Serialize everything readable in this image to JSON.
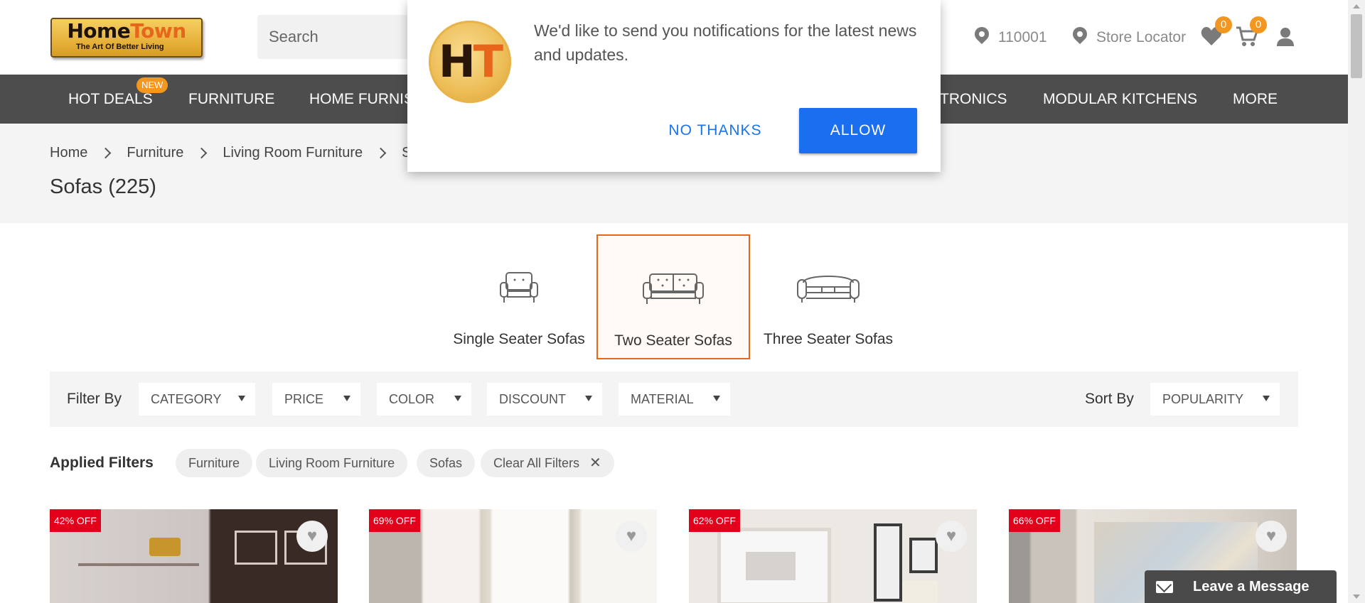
{
  "brand": {
    "name_part1": "Home",
    "name_part2": "Town",
    "tagline": "The Art Of Better Living",
    "accent_color": "#e8651c"
  },
  "header": {
    "search_placeholder": "Search",
    "pincode": "110001",
    "store_locator": "Store Locator",
    "wishlist_count": "0",
    "cart_count": "0",
    "icons": [
      "location-pin-icon",
      "heart-icon",
      "cart-icon",
      "user-icon"
    ]
  },
  "nav": {
    "items": [
      "HOT DEALS",
      "FURNITURE",
      "HOME FURNIS",
      "TRONICS",
      "MODULAR KITCHENS",
      "MORE"
    ],
    "new_badge": "NEW"
  },
  "breadcrumb": [
    "Home",
    "Furniture",
    "Living Room Furniture",
    "Sc"
  ],
  "page": {
    "title": "Sofas (225)"
  },
  "categories": [
    {
      "label": "Single Seater Sofas",
      "icon": "single-sofa-icon",
      "selected": false
    },
    {
      "label": "Two Seater Sofas",
      "icon": "two-seater-sofa-icon",
      "selected": true
    },
    {
      "label": "Three Seater Sofas",
      "icon": "three-seater-sofa-icon",
      "selected": false
    }
  ],
  "filters": {
    "label": "Filter By",
    "options": [
      "CATEGORY",
      "PRICE",
      "COLOR",
      "DISCOUNT",
      "MATERIAL"
    ],
    "sort_label": "Sort By",
    "sort_value": "POPULARITY"
  },
  "applied_filters": {
    "label": "Applied Filters",
    "chips": [
      "Furniture",
      "Living Room Furniture",
      "Sofas"
    ],
    "clear_label": "Clear All Filters"
  },
  "products": [
    {
      "discount": "42% OFF"
    },
    {
      "discount": "69% OFF"
    },
    {
      "discount": "62% OFF"
    },
    {
      "discount": "66% OFF"
    }
  ],
  "notification": {
    "logo_text_1": "H",
    "logo_text_2": "T",
    "message": "We'd like to send you notifications for the latest news and updates.",
    "decline_label": "NO THANKS",
    "allow_label": "ALLOW",
    "allow_color": "#1a6ef0"
  },
  "chat": {
    "label": "Leave a Message"
  }
}
